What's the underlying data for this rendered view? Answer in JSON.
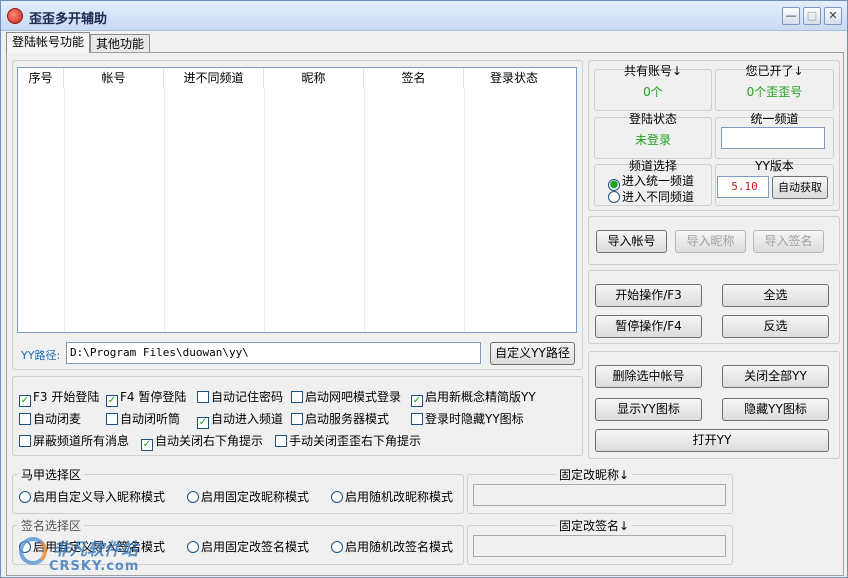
{
  "window": {
    "title": "歪歪多开辅助",
    "min": "—",
    "max": "□",
    "close": "✕"
  },
  "tabs": [
    {
      "label": "登陆帐号功能"
    },
    {
      "label": "其他功能"
    }
  ],
  "accounts_table": {
    "columns": [
      "序号",
      "帐号",
      "进不同频道",
      "昵称",
      "签名",
      "登录状态"
    ]
  },
  "yy_path": {
    "label": "YY路径:",
    "value": "D:\\Program Files\\duowan\\yy\\",
    "button": "自定义YY路径"
  },
  "stats": {
    "total_accounts_title": "共有账号↓",
    "total_accounts_value": "0个",
    "opened_title": "您已开了↓",
    "opened_value": "0个歪歪号",
    "login_status_title": "登陆状态",
    "login_status_value": "未登录",
    "unified_channel_title": "统一频道",
    "unified_channel_value": ""
  },
  "channel_select": {
    "title": "频道选择",
    "options": [
      "进入统一频道",
      "进入不同频道"
    ],
    "selected": 0
  },
  "yy_version": {
    "title": "YY版本",
    "value": "5.10",
    "button": "自动获取"
  },
  "import_buttons": {
    "accounts": "导入帐号",
    "nicknames": "导入昵称",
    "signatures": "导入签名"
  },
  "operation_buttons": {
    "start": "开始操作/F3",
    "select_all": "全选",
    "pause": "暂停操作/F4",
    "invert": "反选"
  },
  "manage_buttons": {
    "delete_selected": "删除选中帐号",
    "close_all": "关闭全部YY",
    "show_icon": "显示YY图标",
    "hide_icon": "隐藏YY图标",
    "open_yy": "打开YY"
  },
  "options": [
    {
      "label": "F3 开始登陆",
      "checked": true
    },
    {
      "label": "F4 暂停登陆",
      "checked": true
    },
    {
      "label": "自动记住密码",
      "checked": false
    },
    {
      "label": "启动网吧模式登录",
      "checked": false
    },
    {
      "label": "启用新概念精简版YY",
      "checked": true
    },
    {
      "label": "自动闭麦",
      "checked": false
    },
    {
      "label": "自动闭听筒",
      "checked": false
    },
    {
      "label": "自动进入频道",
      "checked": true
    },
    {
      "label": "启动服务器模式",
      "checked": false
    },
    {
      "label": "登录时隐藏YY图标",
      "checked": false
    },
    {
      "label": "屏蔽频道所有消息",
      "checked": false
    },
    {
      "label": "自动关闭右下角提示",
      "checked": true
    },
    {
      "label": "手动关闭歪歪右下角提示",
      "checked": false
    }
  ],
  "vest_select": {
    "title": "马甲选择区",
    "options": [
      "启用自定义导入昵称模式",
      "启用固定改昵称模式",
      "启用随机改昵称模式"
    ],
    "fixed_title": "固定改昵称↓",
    "fixed_value": ""
  },
  "signature_select": {
    "title": "签名选择区",
    "options": [
      "启用自定义导入签名模式",
      "启用固定改签名模式",
      "启用随机改签名模式"
    ],
    "fixed_title": "固定改签名↓",
    "fixed_value": ""
  },
  "watermark": {
    "line1": "非凡软件站",
    "line2": "CRSKY.com"
  },
  "colors": {
    "accent_green": "#22a022",
    "title_bar": "#c8daf3"
  }
}
